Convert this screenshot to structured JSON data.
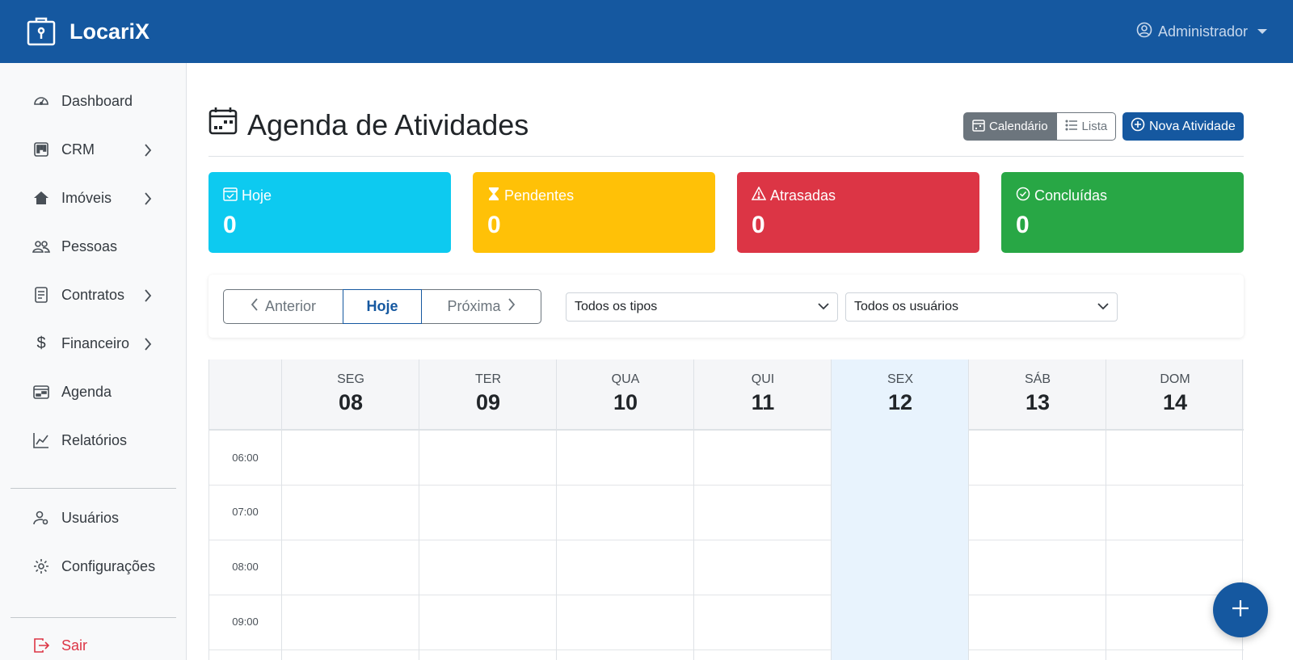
{
  "app": {
    "name": "LocariX"
  },
  "user": {
    "name": "Administrador"
  },
  "sidebar": {
    "items": [
      {
        "label": "Dashboard",
        "icon": "speedometer-icon"
      },
      {
        "label": "CRM",
        "icon": "kanban-icon"
      },
      {
        "label": "Imóveis",
        "icon": "house-icon"
      },
      {
        "label": "Pessoas",
        "icon": "people-icon"
      },
      {
        "label": "Contratos",
        "icon": "file-text-icon"
      },
      {
        "label": "Financeiro",
        "icon": "dollar-icon"
      },
      {
        "label": "Agenda",
        "icon": "calendar-week-icon"
      },
      {
        "label": "Relatórios",
        "icon": "graph-up-icon"
      }
    ],
    "admin_items": [
      {
        "label": "Usuários",
        "icon": "person-gear-icon"
      },
      {
        "label": "Configurações",
        "icon": "gear-icon"
      }
    ],
    "logout": {
      "label": "Sair",
      "icon": "box-arrow-right-icon"
    }
  },
  "page": {
    "title": "Agenda de Atividades",
    "view_calendar": "Calendário",
    "view_list": "Lista",
    "new_activity": "Nova Atividade"
  },
  "stats": [
    {
      "label": "Hoje",
      "value": "0",
      "color": "#0dcaf0",
      "icon": "calendar-check-icon"
    },
    {
      "label": "Pendentes",
      "value": "0",
      "color": "#ffc107",
      "icon": "hourglass-icon"
    },
    {
      "label": "Atrasadas",
      "value": "0",
      "color": "#dc3545",
      "icon": "warning-triangle-icon"
    },
    {
      "label": "Concluídas",
      "value": "0",
      "color": "#28a745",
      "icon": "check-circle-icon"
    }
  ],
  "filters": {
    "prev": "Anterior",
    "today": "Hoje",
    "next": "Próxima",
    "type_select": "Todos os tipos",
    "user_select": "Todos os usuários"
  },
  "calendar": {
    "days": [
      {
        "name": "SEG",
        "date": "08"
      },
      {
        "name": "TER",
        "date": "09"
      },
      {
        "name": "QUA",
        "date": "10"
      },
      {
        "name": "QUI",
        "date": "11"
      },
      {
        "name": "SEX",
        "date": "12"
      },
      {
        "name": "SÁB",
        "date": "13"
      },
      {
        "name": "DOM",
        "date": "14"
      }
    ],
    "today_index": 4,
    "times": [
      "06:00",
      "07:00",
      "08:00",
      "09:00"
    ]
  },
  "colors": {
    "primary": "#1558a0",
    "today_highlight": "#e8f3fd"
  }
}
